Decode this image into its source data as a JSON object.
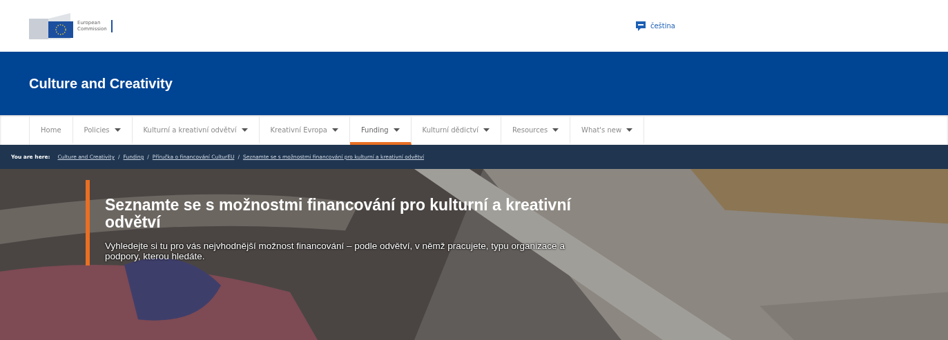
{
  "header": {
    "logo_text": [
      "European",
      "Commission"
    ],
    "language": "čeština"
  },
  "site_title": "Culture and Creativity",
  "nav": [
    {
      "label": "Home",
      "dropdown": false,
      "selected": false
    },
    {
      "label": "Policies",
      "dropdown": true,
      "selected": false
    },
    {
      "label": "Kulturní a kreativní odvětví",
      "dropdown": true,
      "selected": false
    },
    {
      "label": "Kreativní Evropa",
      "dropdown": true,
      "selected": false
    },
    {
      "label": "Funding",
      "dropdown": true,
      "selected": true
    },
    {
      "label": "Kulturní dědictví",
      "dropdown": true,
      "selected": false
    },
    {
      "label": "Resources",
      "dropdown": true,
      "selected": false
    },
    {
      "label": "What's new",
      "dropdown": true,
      "selected": false
    }
  ],
  "breadcrumb": {
    "label": "You are here:",
    "separator": "/",
    "items": [
      "Culture and Creativity",
      "Funding",
      "Příručka o financování CulturEU",
      "Seznamte se s možnostmi financování pro kulturní a kreativní odvětví"
    ]
  },
  "hero": {
    "kind": "picture",
    "title": "Seznamte se s možnostmi financování pro kulturní a kreativní odvětví",
    "text": "Vyhledejte si tu pro vás nejvhodnější možnost financování – podle odvětví, v němž pracujete, typu organizace a podpory, kterou hledáte."
  }
}
